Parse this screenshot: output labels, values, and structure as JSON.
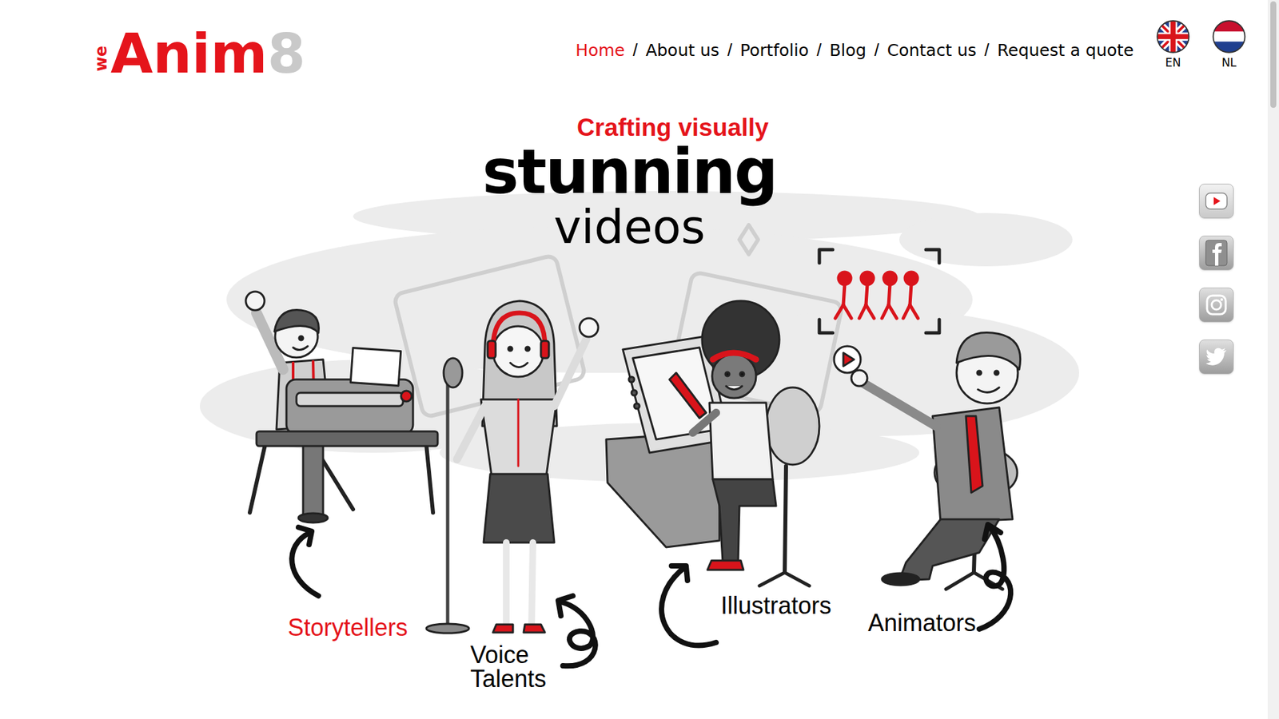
{
  "logo": {
    "prefix": "we",
    "name": "Anim",
    "suffix": "8"
  },
  "nav": [
    {
      "label": "Home",
      "selected": true
    },
    {
      "label": "About us",
      "selected": false
    },
    {
      "label": "Portfolio",
      "selected": false
    },
    {
      "label": "Blog",
      "selected": false
    },
    {
      "label": "Contact us",
      "selected": false
    },
    {
      "label": "Request a quote",
      "selected": false
    }
  ],
  "separator": "/",
  "languages": [
    {
      "label": "EN"
    },
    {
      "label": "NL"
    }
  ],
  "hero": {
    "kicker": "Crafting visually",
    "headline": "stunning",
    "subline": "videos"
  },
  "roles": [
    {
      "label": "Storytellers",
      "highlighted": true
    },
    {
      "label": "Voice Talents",
      "highlighted": false
    },
    {
      "label": "Illustrators",
      "highlighted": false
    },
    {
      "label": "Animators",
      "highlighted": false
    }
  ]
}
